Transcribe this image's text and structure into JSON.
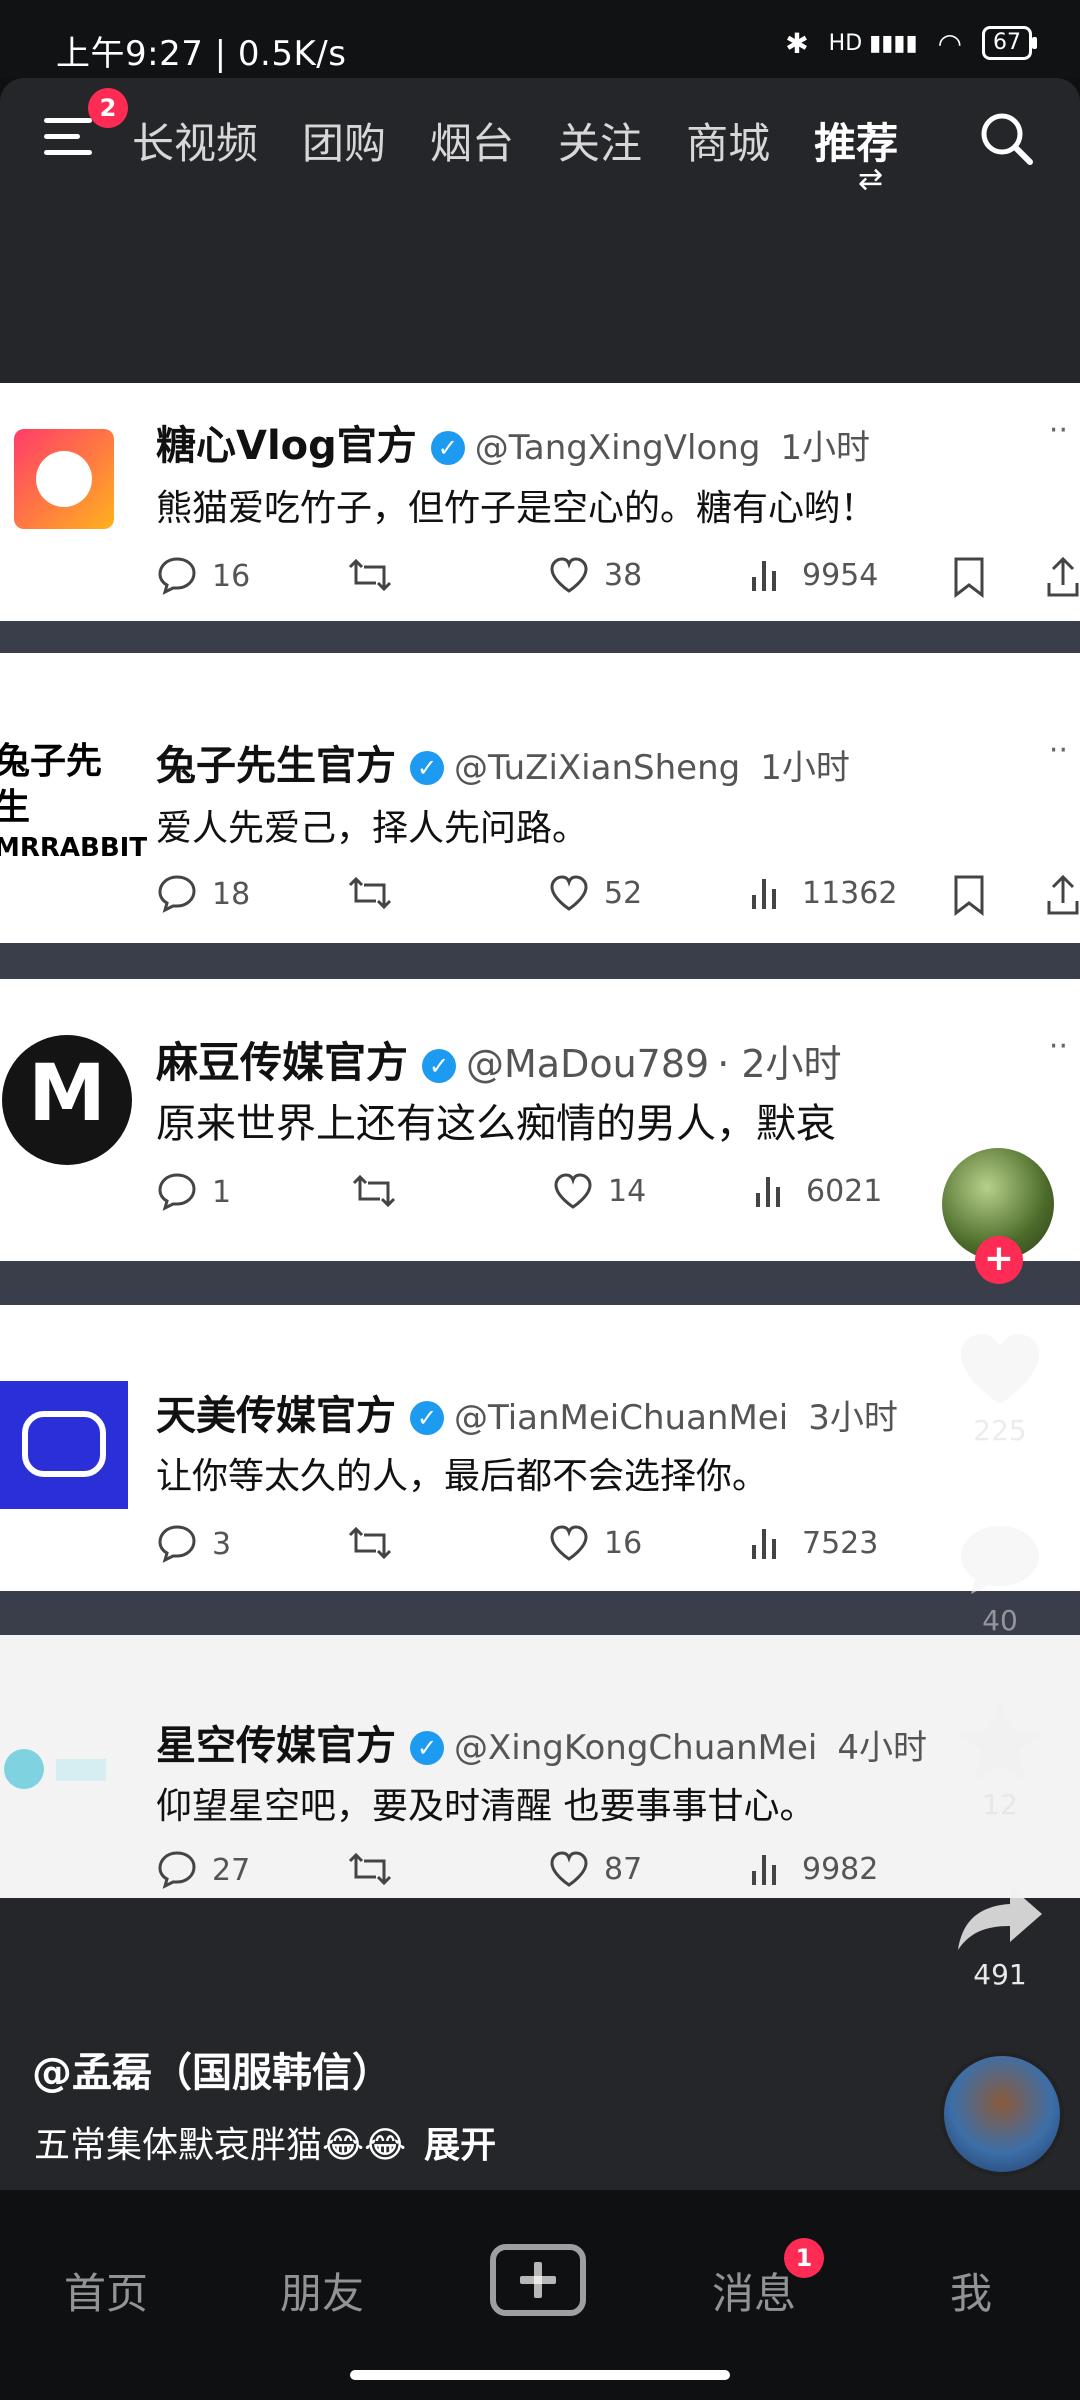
{
  "status_bar": {
    "time_speed": "上午9:27 | 0.5K/s",
    "network": "HD",
    "battery": "67"
  },
  "top_nav": {
    "menu_badge": "2",
    "tabs": [
      "长视频",
      "团购",
      "烟台",
      "关注",
      "商城",
      "推荐"
    ],
    "active_tab": "推荐"
  },
  "posts": [
    {
      "account": "糖心Vlog官方",
      "handle": "@TangXingVlong",
      "time": "1小时",
      "text": "熊猫爱吃竹子，但竹子是空心的。糖有心哟！",
      "replies": "16",
      "likes": "38",
      "views": "9954"
    },
    {
      "account": "兔子先生官方",
      "handle": "@TuZiXianSheng",
      "time": "1小时",
      "text": "爱人先爱己，择人先问路。",
      "replies": "18",
      "likes": "52",
      "views": "11362",
      "logo_text": "兔子先生",
      "logo_sub": "MRRABBIT"
    },
    {
      "account": "麻豆传媒官方",
      "handle": "@MaDou789",
      "time": "· 2小时",
      "text": "原来世界上还有这么痴情的男人，默哀",
      "replies": "1",
      "likes": "14",
      "views": "6021",
      "logo_letter": "M"
    },
    {
      "account": "天美传媒官方",
      "handle": "@TianMeiChuanMei",
      "time": "3小时",
      "text": "让你等太久的人，最后都不会选择你。",
      "replies": "3",
      "likes": "16",
      "views": "7523"
    },
    {
      "account": "星空传媒官方",
      "handle": "@XingKongChuanMei",
      "time": "4小时",
      "text": "仰望星空吧，要及时清醒  也要事事甘心。",
      "replies": "27",
      "likes": "87",
      "views": "9982"
    }
  ],
  "rail": {
    "likes": "225",
    "comments": "40",
    "favorites": "12",
    "shares": "491"
  },
  "caption": {
    "author": "@孟磊（国服韩信）",
    "description": "五常集体默哀胖猫😂😂",
    "expand": "展开"
  },
  "bottom_nav": {
    "home": "首页",
    "friends": "朋友",
    "messages": "消息",
    "messages_badge": "1",
    "me": "我"
  },
  "colors": {
    "accent": "#fe2c55",
    "verified": "#1d9bf0",
    "background": "#24262a"
  }
}
